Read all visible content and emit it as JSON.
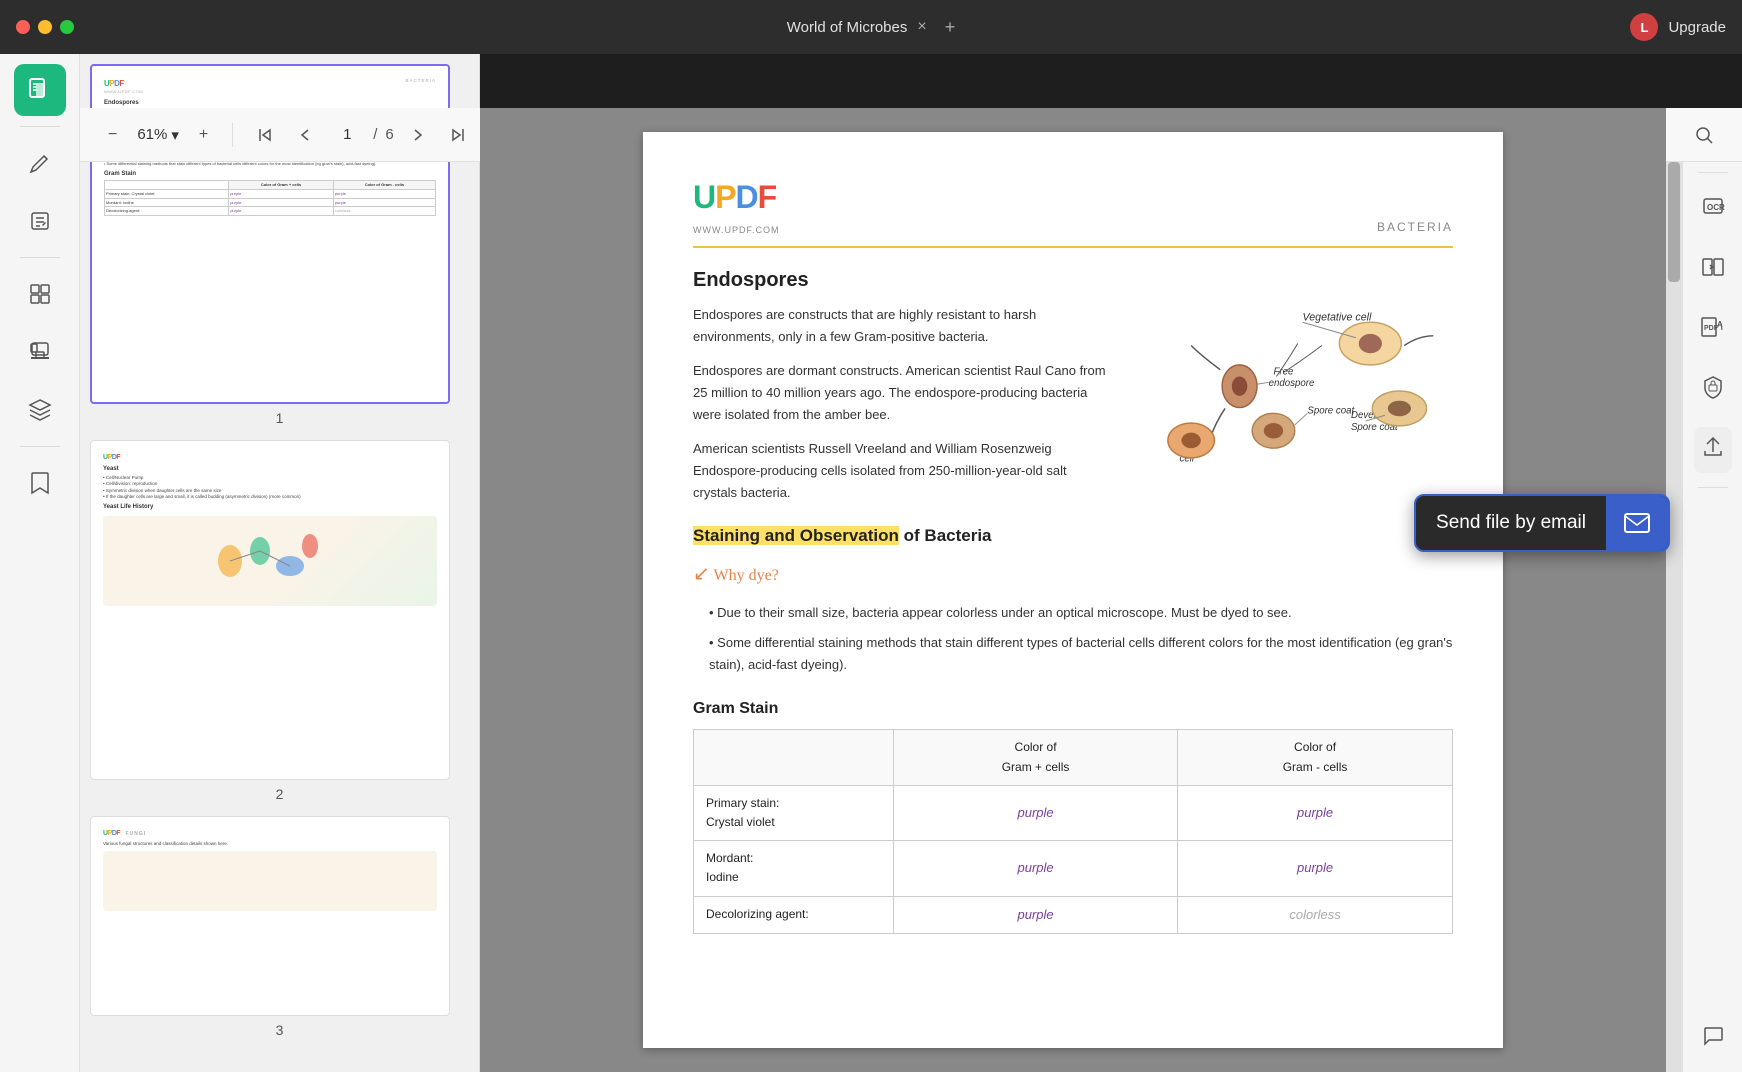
{
  "titlebar": {
    "title": "World of Microbes",
    "close_label": "×",
    "add_tab_label": "+",
    "upgrade_label": "Upgrade",
    "avatar_letter": "L"
  },
  "toolbar": {
    "zoom_out_label": "−",
    "zoom_level": "61%",
    "zoom_dropdown": "▾",
    "zoom_in_label": "+",
    "page_current": "1",
    "page_sep": "/",
    "page_total": "6",
    "first_page_label": "⌃",
    "prev_page_label": "⌃",
    "next_page_label": "⌄",
    "last_page_label": "⌄",
    "present_label": "▭",
    "search_label": "⌕"
  },
  "sidebar": {
    "icons": [
      {
        "name": "reader-icon",
        "label": "Reader",
        "active": true,
        "symbol": "▦"
      },
      {
        "name": "pen-icon",
        "label": "Pen",
        "active": false,
        "symbol": "✏"
      },
      {
        "name": "annotate-icon",
        "label": "Annotate",
        "active": false,
        "symbol": "✎"
      },
      {
        "name": "organize-icon",
        "label": "Organize",
        "active": false,
        "symbol": "⊞"
      },
      {
        "name": "stamp-icon",
        "label": "Stamp",
        "active": false,
        "symbol": "⊕"
      },
      {
        "name": "layers-icon",
        "label": "Layers",
        "active": false,
        "symbol": "⊟"
      },
      {
        "name": "bookmark-icon",
        "label": "Bookmark",
        "active": false,
        "symbol": "🔖"
      }
    ]
  },
  "thumbnails": [
    {
      "number": "1",
      "selected": true,
      "label": "1"
    },
    {
      "number": "2",
      "selected": false,
      "label": "2"
    },
    {
      "number": "3",
      "selected": false,
      "label": "3"
    }
  ],
  "right_panel": {
    "icons": [
      {
        "name": "ocr-icon",
        "symbol": "⊡",
        "label": "OCR"
      },
      {
        "name": "convert-icon",
        "symbol": "⇄",
        "label": "Convert"
      },
      {
        "name": "pdf-ai-icon",
        "symbol": "A/",
        "label": "PDF AI"
      },
      {
        "name": "protect-icon",
        "symbol": "🔒",
        "label": "Protect"
      },
      {
        "name": "share-icon",
        "symbol": "↑",
        "label": "Share"
      },
      {
        "name": "chat-icon",
        "symbol": "💬",
        "label": "Chat"
      }
    ]
  },
  "send_email_tooltip": {
    "label": "Send file by email",
    "icon": "✉"
  },
  "pdf": {
    "logo_text": "UPDF",
    "logo_sub": "WWW.UPDF.COM",
    "bacteria_label": "BACTERIA",
    "section_endospores": "Endospores",
    "endospores_body": "Endospores are constructs that are highly resistant to harsh environments, only in a few Gram-positive bacteria.",
    "endospores_body2": "Endospores are dormant constructs. American scientist Raul Cano from 25 million to 40 million years ago. The endospore-producing bacteria were isolated from the amber bee.",
    "endospores_body3": "American scientists Russell Vreeland and William Rosenzweig Endospore-producing cells isolated from 250-million-year-old salt crystals bacteria.",
    "staining_section": "Staining and Observation of Bacteria",
    "staining_highlight": "Staining and Observation",
    "staining_of": " of Bacteria",
    "why_dye": "Why dye?",
    "bullet1": "Due to their small size, bacteria appear colorless under an optical microscope. Must be dyed to see.",
    "bullet2": "Some differential staining methods that stain different types of bacterial cells different colors for the most identification (eg gran's stain), acid-fast dyeing).",
    "gram_stain": "Gram Stain",
    "gram_col1": "",
    "gram_col2": "Color of\nGram + cells",
    "gram_col3": "Color of\nGram - cells",
    "gram_rows": [
      {
        "label": "Primary stain:\nCrystal violet",
        "plus": "purple",
        "minus": "purple"
      },
      {
        "label": "Mordant:\nIodine",
        "plus": "purple",
        "minus": "purple"
      },
      {
        "label": "Decolorizing agent:",
        "plus": "purple",
        "minus": "colorless"
      }
    ],
    "diagram_labels": {
      "vegetative_cell": "Vegetative cell",
      "free_endospore": "Free\nendospore",
      "spore_coat": "Spore coat",
      "developing_spore_coat": "Developing\nSpore coat",
      "mother_cell": "Mother\ncell"
    }
  }
}
